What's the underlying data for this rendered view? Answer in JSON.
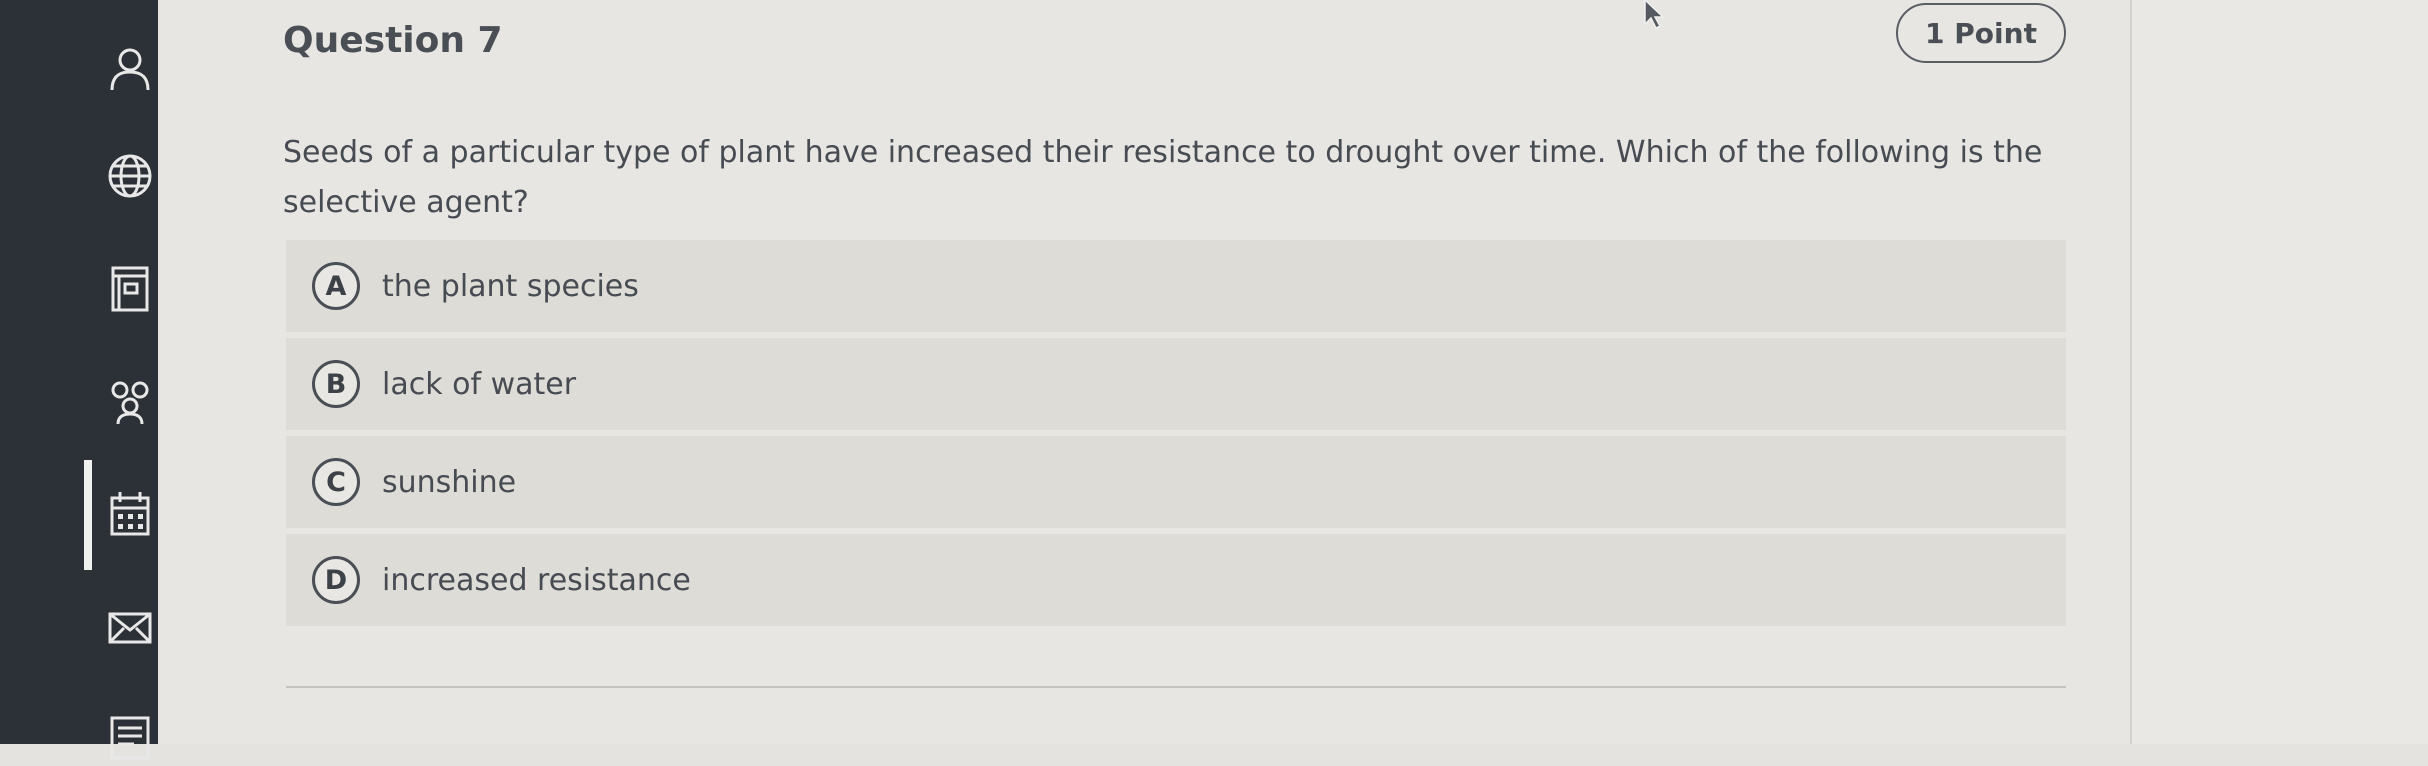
{
  "sidebar": {
    "icons": [
      {
        "name": "profile-icon"
      },
      {
        "name": "globe-icon"
      },
      {
        "name": "course-icon"
      },
      {
        "name": "groups-icon"
      },
      {
        "name": "calendar-icon"
      },
      {
        "name": "messages-icon"
      },
      {
        "name": "grades-icon"
      }
    ],
    "active_index": 4
  },
  "question": {
    "title": "Question 7",
    "points": "1 Point",
    "text": "Seeds of a particular type of plant have increased their resistance to drought over time. Which of the following is the selective agent?",
    "options": [
      {
        "letter": "A",
        "text": "the plant species"
      },
      {
        "letter": "B",
        "text": "lack of water"
      },
      {
        "letter": "C",
        "text": "sunshine"
      },
      {
        "letter": "D",
        "text": "increased resistance"
      }
    ]
  },
  "colors": {
    "sidebar": "#2c3138",
    "content": "#e7e6e2",
    "option_bg": "#dedcd7",
    "text": "#474b52"
  }
}
